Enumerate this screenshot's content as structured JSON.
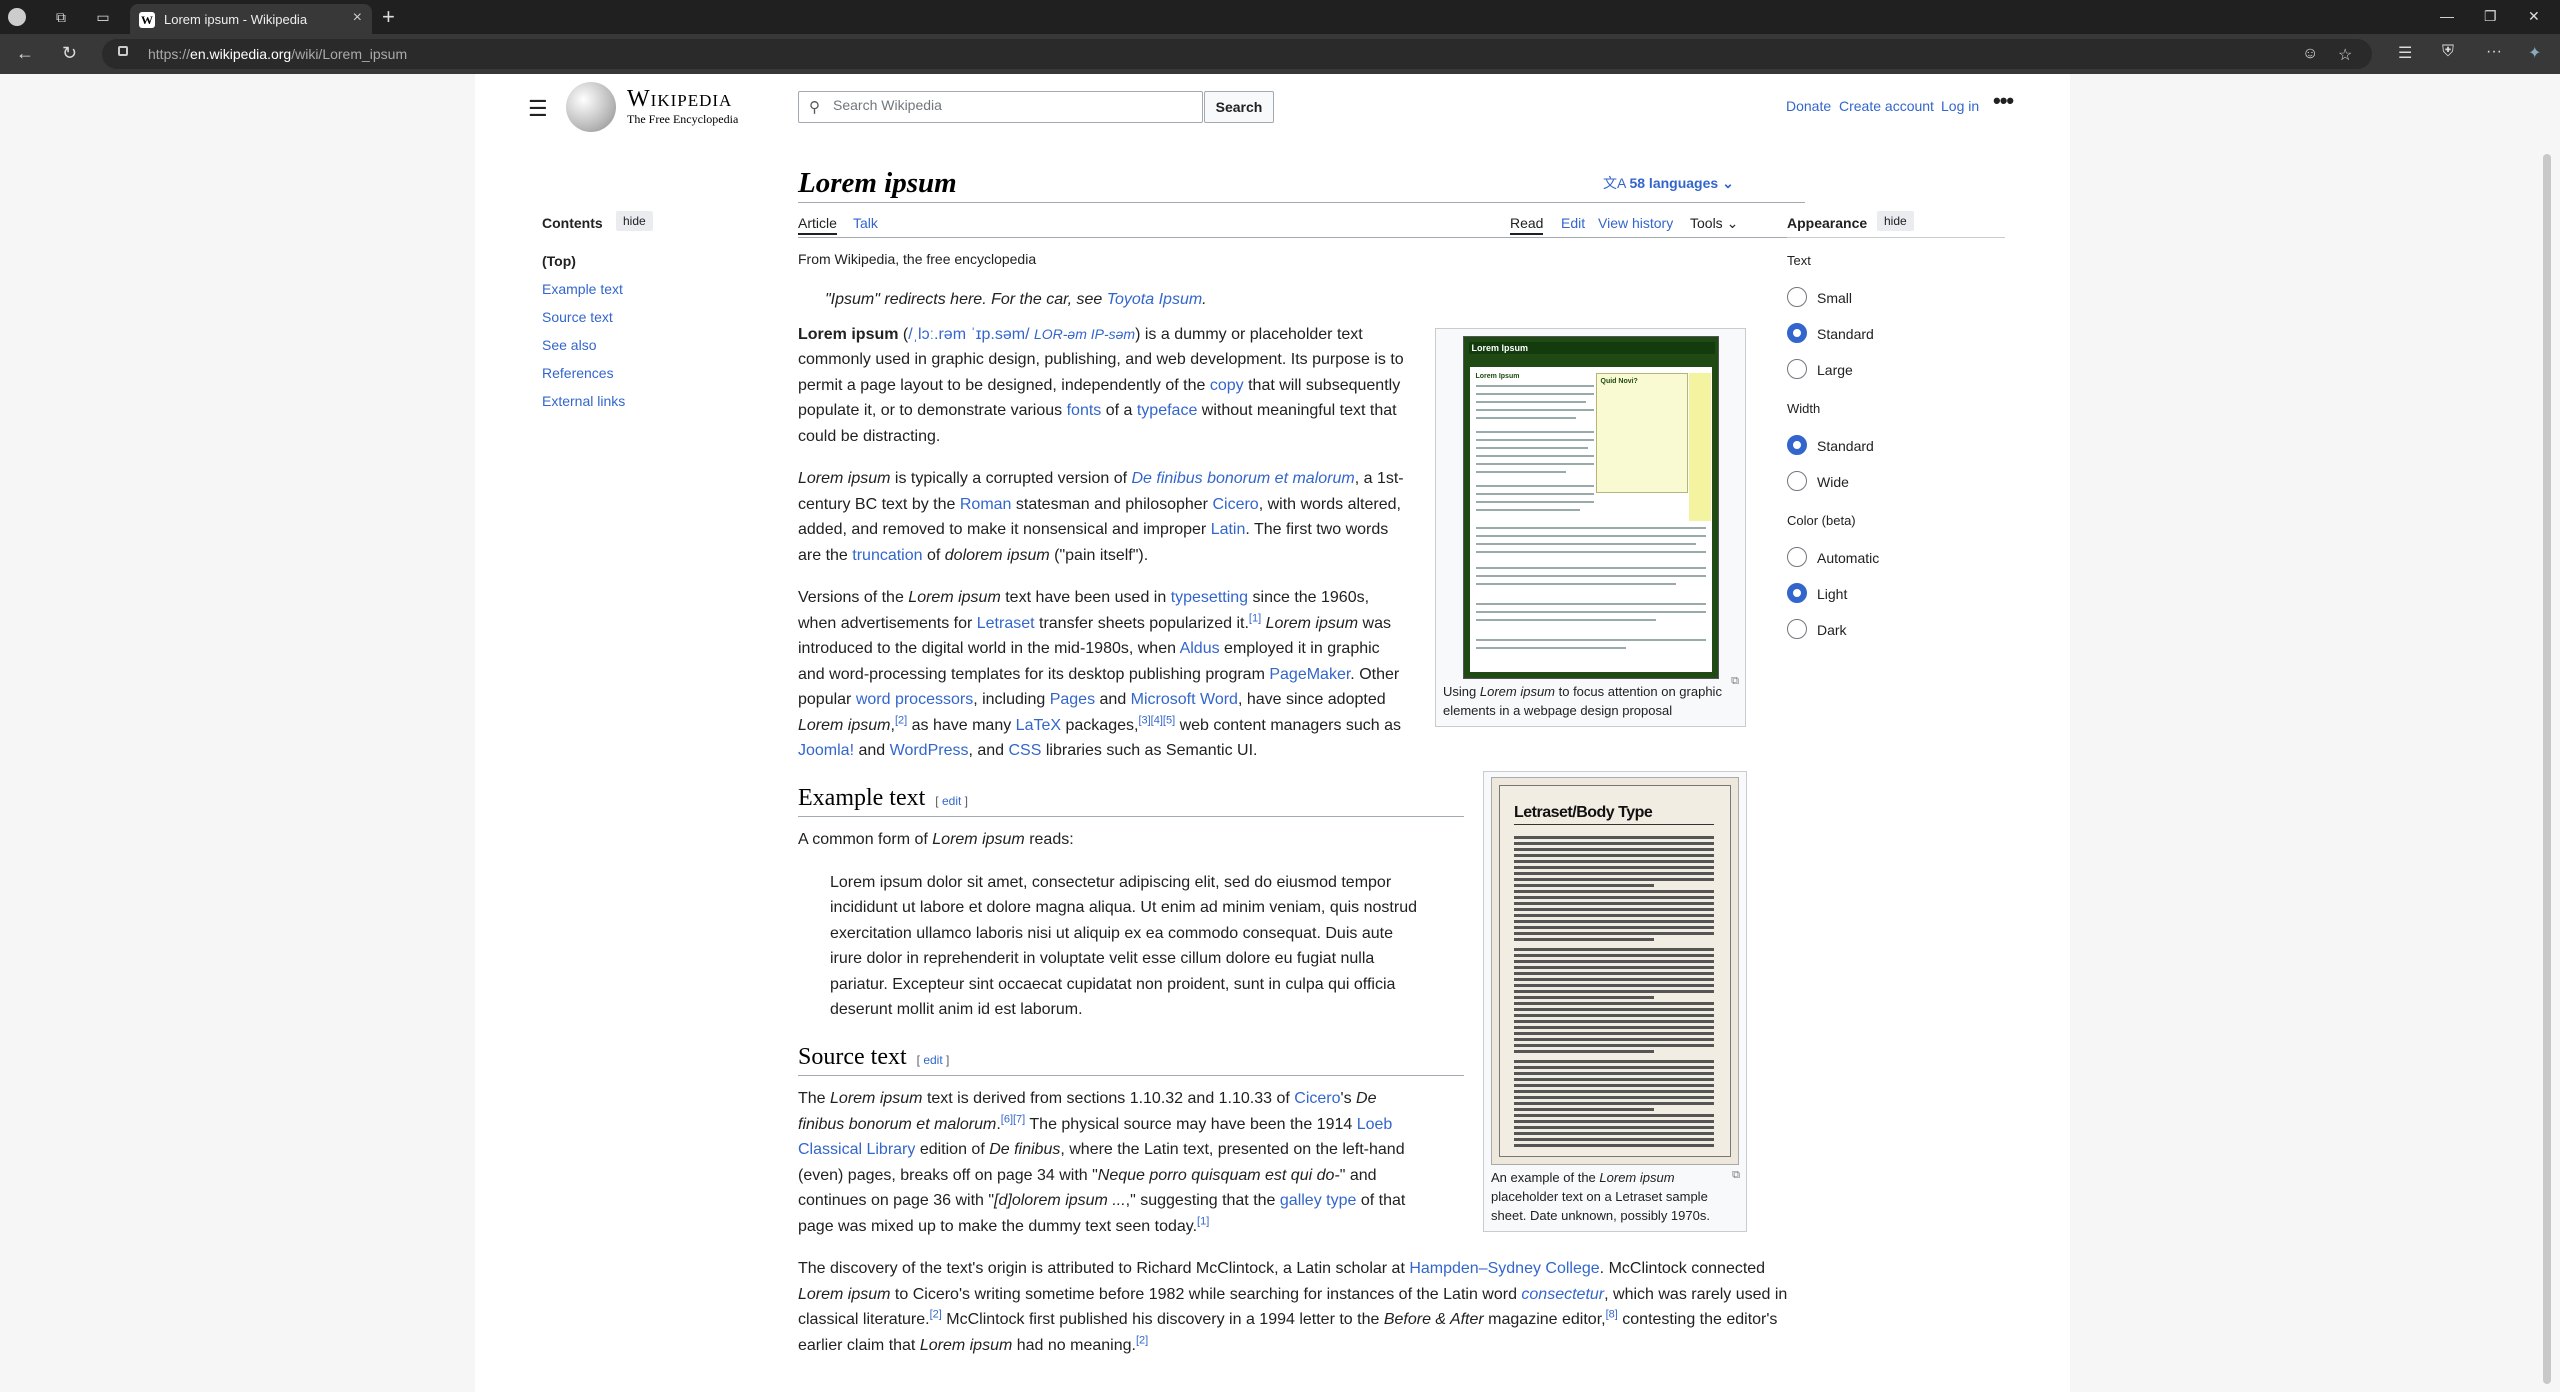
{
  "browser": {
    "tab_title": "Lorem ipsum - Wikipedia",
    "tab_favicon": "W",
    "url_prefix": "https://",
    "url_domain": "en.wikipedia.org",
    "url_path": "/wiki/Lorem_ipsum"
  },
  "header": {
    "logo_wordmark": "Wikipedia",
    "logo_tagline": "The Free Encyclopedia",
    "search_placeholder": "Search Wikipedia",
    "search_button": "Search",
    "donate": "Donate",
    "create_account": "Create account",
    "log_in": "Log in"
  },
  "toc": {
    "heading": "Contents",
    "hide": "hide",
    "items": [
      "(Top)",
      "Example text",
      "Source text",
      "See also",
      "References",
      "External links"
    ]
  },
  "article": {
    "title": "Lorem ipsum",
    "languages": "58 languages",
    "tab_article": "Article",
    "tab_talk": "Talk",
    "tab_read": "Read",
    "tab_edit": "Edit",
    "tab_history": "View history",
    "tab_tools": "Tools",
    "from": "From Wikipedia, the free encyclopedia",
    "hatnote_a": "\"Ipsum\" redirects here. For the car, see ",
    "hatnote_link": "Toyota Ipsum",
    "hatnote_b": ".",
    "p1": {
      "bold": "Lorem ipsum",
      "t1": " (",
      "ipa": "/ˌlɔː.rəm ˈɪp.səm/",
      "resp": "LOR-əm IP-səm",
      "t2": ") is a dummy or placeholder text commonly used in graphic design, publishing, and web development. Its purpose is to permit a page layout to be designed, independently of the ",
      "copy": "copy",
      "t3": " that will subsequently populate it, or to demonstrate various ",
      "fonts": "fonts",
      "t4": " of a ",
      "typeface": "typeface",
      "t5": " without meaningful text that could be distracting."
    },
    "p2": {
      "lorem": "Lorem ipsum",
      "t1": " is typically a corrupted version of ",
      "definibus": "De finibus bonorum et malorum",
      "t2": ", a 1st-century BC text by the ",
      "roman": "Roman",
      "t3": " statesman and philosopher ",
      "cicero": "Cicero",
      "t4": ", with words altered, added, and removed to make it nonsensical and improper ",
      "latin": "Latin",
      "t5": ". The first two words are the ",
      "truncation": "truncation",
      "t6": " of ",
      "dolorem": "dolorem ipsum",
      "t7": " (\"pain itself\")."
    },
    "p3": {
      "t1": "Versions of the ",
      "lorem": "Lorem ipsum",
      "t2": " text have been used in ",
      "typesetting": "typesetting",
      "t3": " since the 1960s, when advertisements for ",
      "letraset": "Letraset",
      "t4": " transfer sheets popularized it.",
      "ref1": "[1]",
      "t5": " ",
      "lorem2": "Lorem ipsum",
      "t6": " was introduced to the digital world in the mid-1980s, when ",
      "aldus": "Aldus",
      "t7": " employed it in graphic and word-processing templates for its desktop publishing program ",
      "pagemaker": "PageMaker",
      "t8": ". Other popular ",
      "wp": "word processors",
      "t9": ", including ",
      "pages": "Pages",
      "t10": " and ",
      "msword": "Microsoft Word",
      "t11": ", have since adopted ",
      "lorem3": "Lorem ipsum",
      "t12": ",",
      "ref2": "[2]",
      "t13": " as have many ",
      "latex": "LaTeX",
      "t14": " packages,",
      "ref345": "[3][4][5]",
      "t15": " web content managers such as ",
      "joomla": "Joomla!",
      "t16": " and ",
      "wordpress": "WordPress",
      "t17": ", and ",
      "css": "CSS",
      "t18": " libraries such as Semantic UI."
    },
    "h_example": "Example text",
    "edit": "edit",
    "example_intro_a": "A common form of ",
    "example_intro_i": "Lorem ipsum",
    "example_intro_b": " reads:",
    "example_quote": "Lorem ipsum dolor sit amet, consectetur adipiscing elit, sed do eiusmod tempor incididunt ut labore et dolore magna aliqua. Ut enim ad minim veniam, quis nostrud exercitation ullamco laboris nisi ut aliquip ex ea commodo consequat. Duis aute irure dolor in reprehenderit in voluptate velit esse cillum dolore eu fugiat nulla pariatur. Excepteur sint occaecat cupidatat non proident, sunt in culpa qui officia deserunt mollit anim id est laborum.",
    "h_source": "Source text",
    "p4": {
      "t1": "The ",
      "lorem": "Lorem ipsum",
      "t2": " text is derived from sections 1.10.32 and 1.10.33 of ",
      "cicero": "Cicero",
      "t3": "'s ",
      "definibus": "De finibus bonorum et malorum",
      "t4": ".",
      "ref67": "[6][7]",
      "t5": " The physical source may have been the 1914 ",
      "loeb": "Loeb Classical Library",
      "t6": " edition of ",
      "definibus2": "De finibus",
      "t7": ", where the Latin text, presented on the left-hand (even) pages, breaks off on page 34 with \"",
      "neque": "Neque porro quisquam est qui do-",
      "t8": "\" and continues on page 36 with \"",
      "ipsum": "[d]olorem ipsum ...",
      "t9": ",\" suggesting that the ",
      "galley": "galley type",
      "t10": " of that page was mixed up to make the dummy text seen today.",
      "ref1": "[1]"
    },
    "p5": {
      "t1": "The discovery of the text's origin is attributed to Richard McClintock, a Latin scholar at ",
      "hampden": "Hampden–Sydney College",
      "t2": ". McClintock connected ",
      "lorem": "Lorem ipsum",
      "t3": " to Cicero's writing sometime before 1982 while searching for instances of the Latin word ",
      "consectetur": "consectetur",
      "t4": ", which was rarely used in classical literature.",
      "ref2": "[2]",
      "t5": " McClintock first published his discovery in a 1994 letter to the ",
      "ba": "Before & After",
      "t6": " magazine editor,",
      "ref8": "[8]",
      "t7": " contesting the editor's earlier claim that ",
      "lorem2": "Lorem ipsum",
      "t8": " had no meaning.",
      "ref2b": "[2]"
    }
  },
  "figure1": {
    "cap_a": "Using ",
    "cap_i": "Lorem ipsum",
    "cap_b": " to focus attention on graphic elements in a webpage design proposal",
    "img_bar": "Lorem Ipsum",
    "img_h1": "Lorem Ipsum",
    "img_h2": "Quid Novi?"
  },
  "figure2": {
    "cap_a": "An example of the ",
    "cap_i": "Lorem ipsum",
    "cap_b": " placeholder text on a Letraset sample sheet. Date unknown, possibly 1970s.",
    "img_heading": "Letraset/Body Type"
  },
  "appearance": {
    "heading": "Appearance",
    "hide": "hide",
    "text_label": "Text",
    "text_opts": [
      "Small",
      "Standard",
      "Large"
    ],
    "text_selected": "Standard",
    "width_label": "Width",
    "width_opts": [
      "Standard",
      "Wide"
    ],
    "width_selected": "Standard",
    "color_label": "Color (beta)",
    "color_opts": [
      "Automatic",
      "Light",
      "Dark"
    ],
    "color_selected": "Light"
  },
  "colors": {
    "link": "#3366cc",
    "accent": "#36c",
    "text": "#202122"
  }
}
